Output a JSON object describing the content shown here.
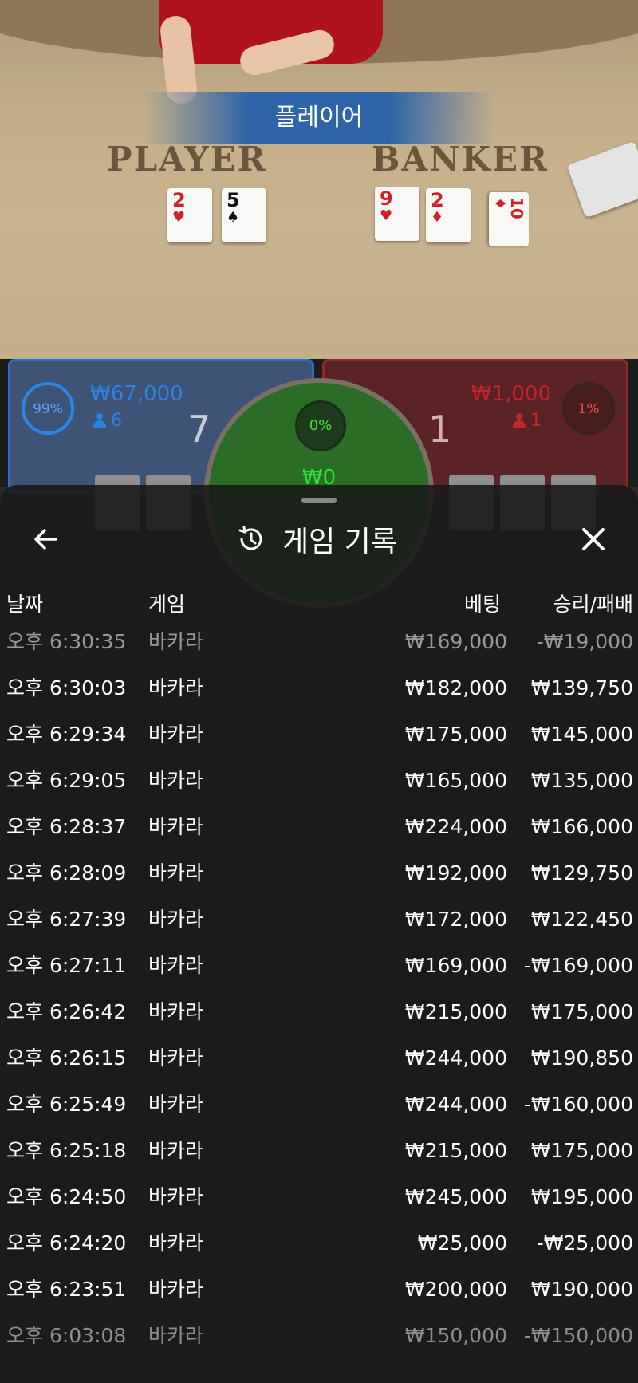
{
  "table": {
    "result_banner": "플레이어",
    "player_word": "PLAYER",
    "banker_word": "BANKER",
    "player_cards": [
      {
        "rank": "2",
        "suit": "♥",
        "color": "red"
      },
      {
        "rank": "5",
        "suit": "♠",
        "color": "black"
      }
    ],
    "banker_cards": [
      {
        "rank": "9",
        "suit": "♥",
        "color": "red"
      },
      {
        "rank": "2",
        "suit": "♦",
        "color": "red"
      },
      {
        "rank": "10",
        "suit": "♦",
        "color": "red"
      }
    ]
  },
  "bets": {
    "player": {
      "percent": "99%",
      "amount": "₩67,000",
      "count": "6",
      "score": "7"
    },
    "tie": {
      "percent": "0%",
      "amount": "₩0"
    },
    "banker": {
      "percent": "1%",
      "amount": "₩1,000",
      "count": "1",
      "score": "1"
    }
  },
  "history": {
    "title": "게임 기록",
    "columns": {
      "date": "날짜",
      "game": "게임",
      "bet": "베팅",
      "win_loss": "승리/패배"
    },
    "rows": [
      {
        "date": "오후 6:30:35",
        "game": "바카라",
        "bet": "₩169,000",
        "win_loss": "-₩19,000"
      },
      {
        "date": "오후 6:30:03",
        "game": "바카라",
        "bet": "₩182,000",
        "win_loss": "₩139,750"
      },
      {
        "date": "오후 6:29:34",
        "game": "바카라",
        "bet": "₩175,000",
        "win_loss": "₩145,000"
      },
      {
        "date": "오후 6:29:05",
        "game": "바카라",
        "bet": "₩165,000",
        "win_loss": "₩135,000"
      },
      {
        "date": "오후 6:28:37",
        "game": "바카라",
        "bet": "₩224,000",
        "win_loss": "₩166,000"
      },
      {
        "date": "오후 6:28:09",
        "game": "바카라",
        "bet": "₩192,000",
        "win_loss": "₩129,750"
      },
      {
        "date": "오후 6:27:39",
        "game": "바카라",
        "bet": "₩172,000",
        "win_loss": "₩122,450"
      },
      {
        "date": "오후 6:27:11",
        "game": "바카라",
        "bet": "₩169,000",
        "win_loss": "-₩169,000"
      },
      {
        "date": "오후 6:26:42",
        "game": "바카라",
        "bet": "₩215,000",
        "win_loss": "₩175,000"
      },
      {
        "date": "오후 6:26:15",
        "game": "바카라",
        "bet": "₩244,000",
        "win_loss": "₩190,850"
      },
      {
        "date": "오후 6:25:49",
        "game": "바카라",
        "bet": "₩244,000",
        "win_loss": "-₩160,000"
      },
      {
        "date": "오후 6:25:18",
        "game": "바카라",
        "bet": "₩215,000",
        "win_loss": "₩175,000"
      },
      {
        "date": "오후 6:24:50",
        "game": "바카라",
        "bet": "₩245,000",
        "win_loss": "₩195,000"
      },
      {
        "date": "오후 6:24:20",
        "game": "바카라",
        "bet": "₩25,000",
        "win_loss": "-₩25,000"
      },
      {
        "date": "오후 6:23:51",
        "game": "바카라",
        "bet": "₩200,000",
        "win_loss": "₩190,000"
      },
      {
        "date": "오후 6:03:08",
        "game": "바카라",
        "bet": "₩150,000",
        "win_loss": "-₩150,000"
      }
    ]
  },
  "icons": {
    "back": "arrow-left-icon",
    "history": "history-clock-icon",
    "close": "close-x-icon"
  },
  "colors": {
    "player_blue": "#2e82e0",
    "banker_red": "#c4252b",
    "tie_green": "#2de03a",
    "sheet_bg": "#1a1a1a"
  }
}
